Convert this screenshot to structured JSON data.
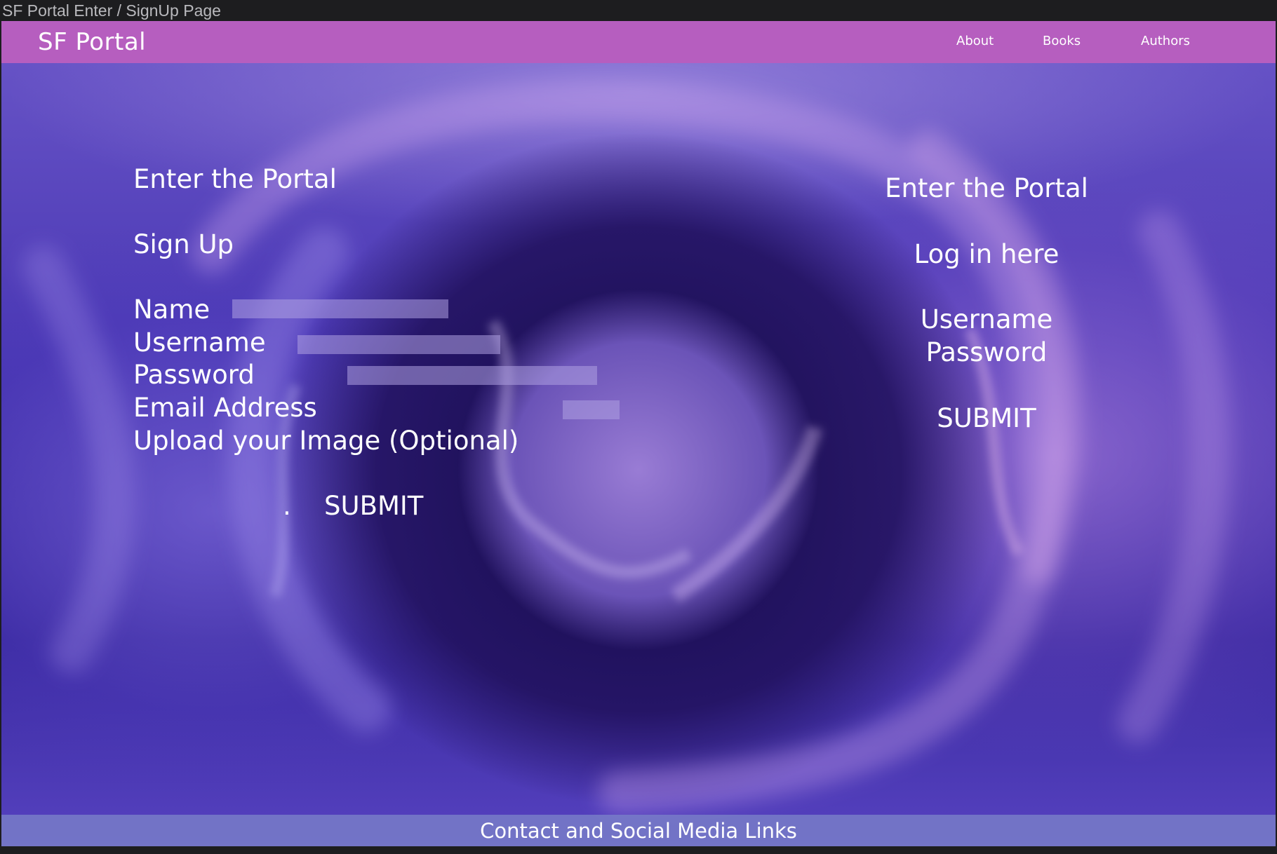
{
  "window": {
    "title": "SF Portal Enter / SignUp Page"
  },
  "header": {
    "brand": "SF Portal",
    "nav": {
      "about": "About",
      "books": "Books",
      "authors": "Authors"
    },
    "bar_color": "#b65ebf"
  },
  "signup": {
    "heading": "Enter the Portal",
    "subheading": "Sign Up",
    "name_label": "Name",
    "name_value": "",
    "username_label": "Username",
    "username_value": "",
    "password_label": "Password",
    "password_value": "",
    "email_label": "Email Address",
    "email_value": "",
    "upload_label": "Upload your Image (Optional)",
    "dot": ".",
    "submit_label": "SUBMIT"
  },
  "login": {
    "heading": "Enter the Portal",
    "subheading": "Log in here",
    "username_label": "Username",
    "password_label": "Password",
    "submit_label": "SUBMIT"
  },
  "footer": {
    "text": "Contact and Social Media Links"
  },
  "icons": {
    "background": "purple-smoke-portal-image"
  }
}
